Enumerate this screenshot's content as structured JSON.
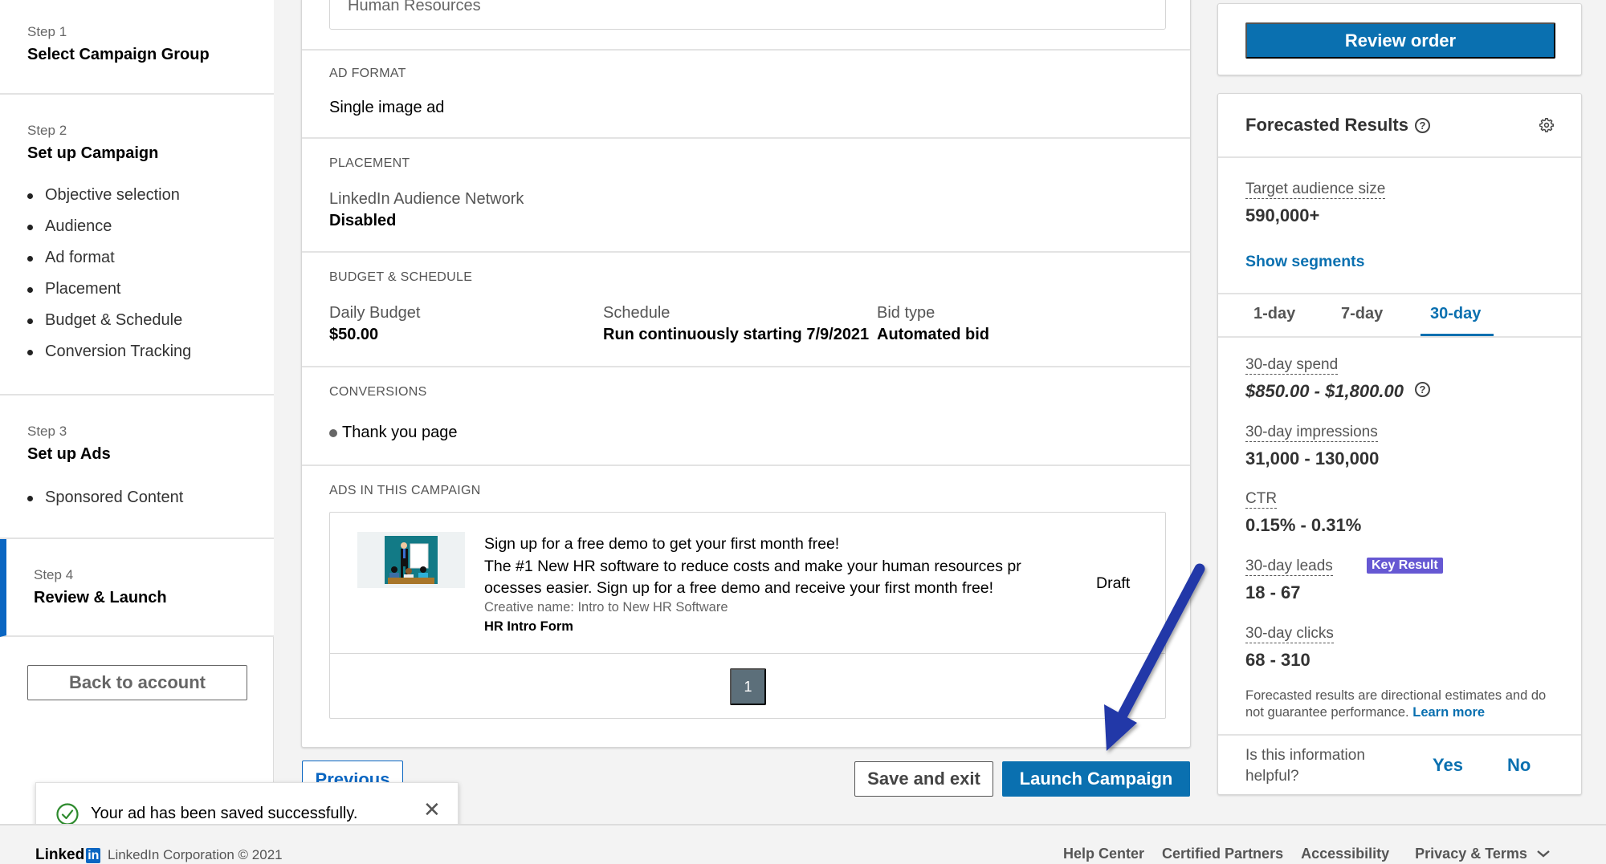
{
  "sidebar": {
    "steps": [
      {
        "num": "Step 1",
        "title": "Select Campaign Group",
        "items": []
      },
      {
        "num": "Step 2",
        "title": "Set up Campaign",
        "items": [
          "Objective selection",
          "Audience",
          "Ad format",
          "Placement",
          "Budget & Schedule",
          "Conversion Tracking"
        ]
      },
      {
        "num": "Step 3",
        "title": "Set up Ads",
        "items": [
          "Sponsored Content"
        ]
      },
      {
        "num": "Step 4",
        "title": "Review & Launch",
        "items": [],
        "active": true
      }
    ],
    "back_button": "Back to account"
  },
  "main": {
    "audience_partial_value": "Human Resources",
    "ad_format": {
      "label": "AD FORMAT",
      "value": "Single image ad"
    },
    "placement": {
      "label": "PLACEMENT",
      "network": "LinkedIn Audience Network",
      "status": "Disabled"
    },
    "budget": {
      "label": "BUDGET & SCHEDULE",
      "daily_budget_label": "Daily Budget",
      "daily_budget_value": "$50.00",
      "schedule_label": "Schedule",
      "schedule_value": "Run continuously starting 7/9/2021",
      "bid_type_label": "Bid type",
      "bid_type_value": "Automated bid"
    },
    "conversions": {
      "label": "CONVERSIONS",
      "items": [
        "Thank you page"
      ]
    },
    "ads": {
      "label": "ADS IN THIS CAMPAIGN",
      "items": [
        {
          "headline": "Sign up for a free demo to get your first month free!",
          "body_line1": "The #1 New HR software to reduce costs and make your human resources pr",
          "body_line2": "ocesses easier. Sign up for a free demo and receive your first month free!",
          "creative_name": "Creative name: Intro to New HR Software",
          "form_name": "HR Intro Form",
          "status": "Draft"
        }
      ],
      "pagination": {
        "current_page": "1"
      }
    },
    "buttons": {
      "previous": "Previous",
      "save_and_exit": "Save and exit",
      "launch": "Launch Campaign"
    }
  },
  "toast": {
    "message": "Your ad has been saved successfully.",
    "icon": "check-circle-icon",
    "close_icon": "close-icon",
    "close_glyph": "✕"
  },
  "footer": {
    "logo_text": "Linked",
    "logo_in": "in",
    "copyright": "LinkedIn Corporation © 2021",
    "links": [
      "Help Center",
      "Certified Partners",
      "Accessibility",
      "Privacy & Terms"
    ]
  },
  "right": {
    "review_button": "Review order",
    "forecast": {
      "title": "Forecasted Results",
      "help_glyph": "?",
      "target_audience_label": "Target audience size",
      "target_audience_value": "590,000+",
      "show_segments": "Show segments",
      "tabs": [
        {
          "label": "1-day",
          "active": false
        },
        {
          "label": "7-day",
          "active": false
        },
        {
          "label": "30-day",
          "active": true
        }
      ],
      "metrics": [
        {
          "label": "30-day spend",
          "value": "$850.00 - $1,800.00"
        },
        {
          "label": "30-day impressions",
          "value": "31,000 - 130,000"
        },
        {
          "label": "CTR",
          "value": "0.15% - 0.31%"
        },
        {
          "label": "30-day leads",
          "value": "18 - 67",
          "badge": "Key Result"
        },
        {
          "label": "30-day clicks",
          "value": "68 - 310"
        }
      ],
      "disclaimer": "Forecasted results are directional estimates and do not guarantee performance.",
      "learn_more": "Learn more",
      "helpful_question": "Is this information helpful?",
      "yes": "Yes",
      "no": "No"
    }
  },
  "colors": {
    "brand_blue": "#0a70b0",
    "active_step_bar": "#0a66c2",
    "key_result_badge": "#6658d3",
    "annotation_arrow": "#2338a8",
    "success_green": "#2d8a2d"
  }
}
